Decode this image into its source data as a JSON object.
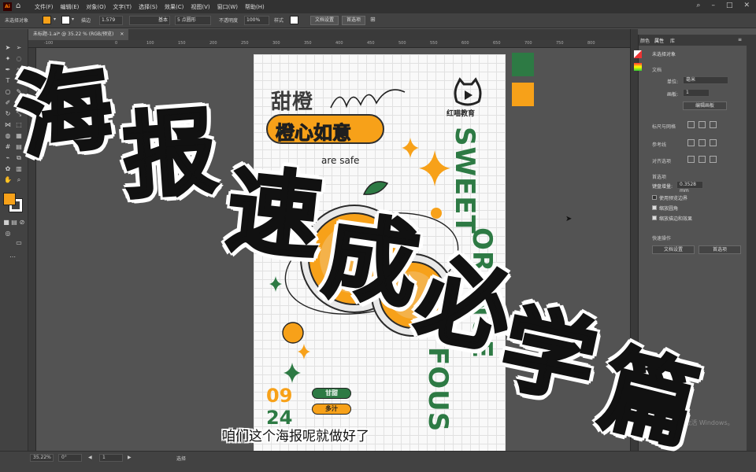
{
  "app": {
    "logo": "Ai"
  },
  "menu": [
    "文件(F)",
    "编辑(E)",
    "对象(O)",
    "文字(T)",
    "选择(S)",
    "效果(C)",
    "视图(V)",
    "窗口(W)",
    "帮助(H)"
  ],
  "control_bar": {
    "no_selection": "未选择对象",
    "stroke_label": "描边",
    "stroke_value": "1.579",
    "brush_label": "基本",
    "shape_label": "5 点圆形",
    "opacity_label": "不透明度",
    "opacity_value": "100%",
    "style_label": "样式",
    "doc_setup_button": "文档设置",
    "prefs_button": "首选项"
  },
  "tab": {
    "label": "未标题-1.ai* @ 35.22 % (RGB/预览)"
  },
  "ruler_ticks": [
    "-100",
    "0",
    "100",
    "150",
    "200",
    "250",
    "300",
    "350",
    "400",
    "450",
    "500",
    "550",
    "600",
    "650",
    "700",
    "750",
    "800"
  ],
  "poster": {
    "logo_text": "红喵教育",
    "title_line1": "甜橙",
    "title_line2": "橙心如意",
    "tagline": "are safe",
    "vertical_1": "SWEET",
    "vertical_2": "ORANGE",
    "vertical_3": "FOUS",
    "date_top": "09",
    "date_bottom": "24",
    "tag_1": "甘甜",
    "tag_2": "多汁",
    "colors": {
      "green": "#2d7a44",
      "orange": "#f7a119"
    }
  },
  "overlay_title": [
    "海",
    "报",
    "速",
    "成",
    "必",
    "学",
    "篇"
  ],
  "subtitle": "咱们这个海报呢就做好了",
  "right_panel": {
    "tab_color": "颜色",
    "tab_properties": "属性",
    "tab_library": "库",
    "no_selection": "未选择对象",
    "doc_label": "文档",
    "unit_label": "单位:",
    "unit_value": "毫米",
    "artboard_label": "画板:",
    "artboard_value": "1",
    "edit_artboard_button": "编辑画板",
    "ruler_grid_label": "标尺与网格",
    "guides_label": "参考线",
    "align_label": "对齐选项",
    "prefs_label": "首选项",
    "keyboard_increment_label": "键盘增量:",
    "keyboard_increment_value": "0.3528 mm",
    "preview_bounds_label": "使用预览边界",
    "scale_corners_label": "缩放圆角",
    "scale_strokes_label": "缩放描边和效果",
    "quick_actions_label": "快速操作",
    "doc_setup_button": "文档设置",
    "prefs_button": "首选项",
    "activation_line1": "激活 Windows",
    "activation_line2": "转到\"设置\"以激活 Windows。"
  },
  "status_bar": {
    "zoom": "35.22%",
    "rotation": "0°",
    "artboard": "1",
    "tool": "选择"
  }
}
